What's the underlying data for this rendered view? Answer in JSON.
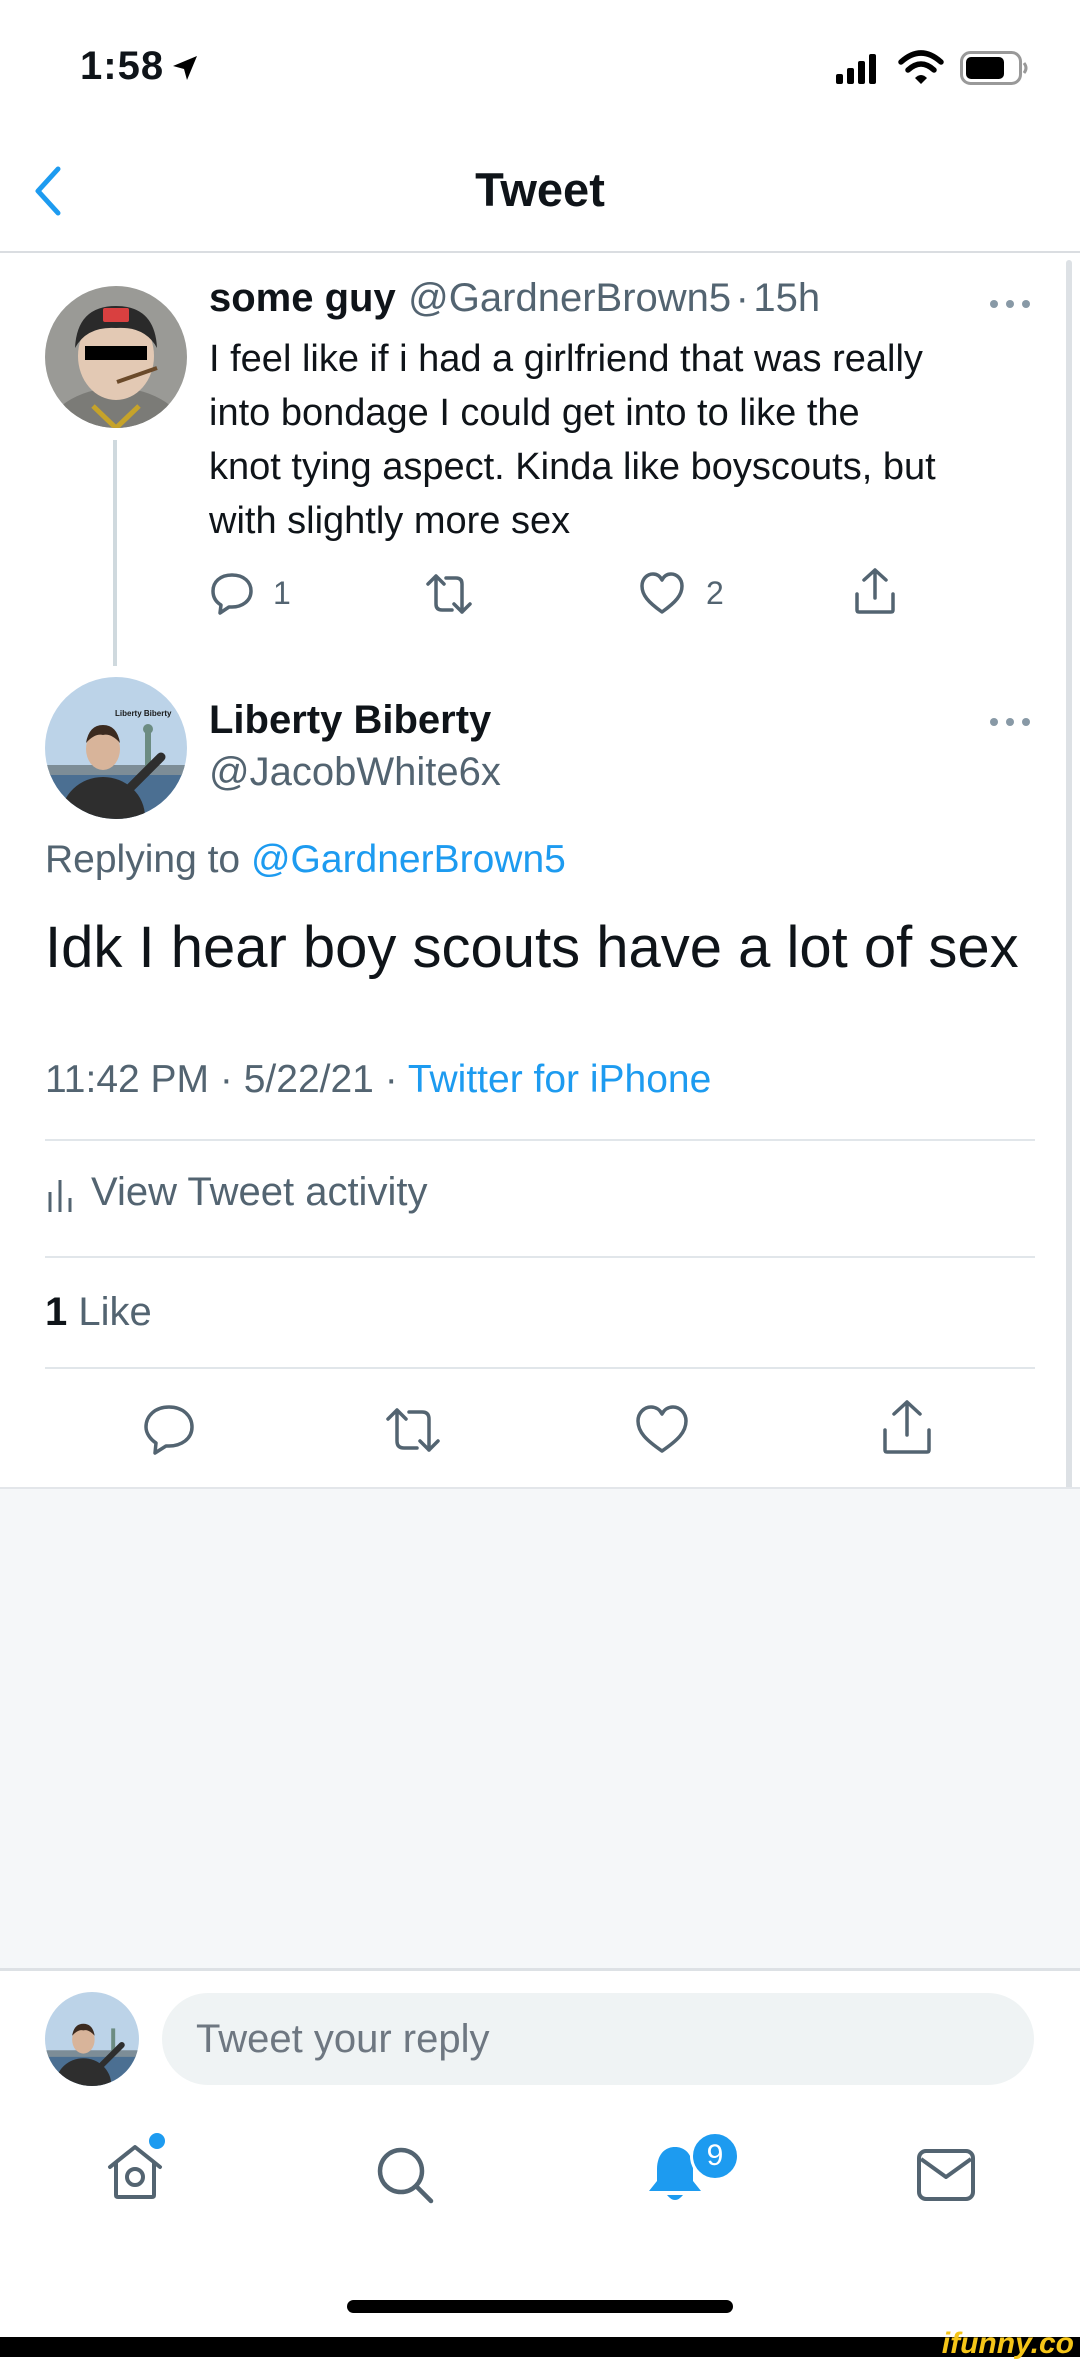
{
  "status_bar": {
    "time": "1:58"
  },
  "nav": {
    "title": "Tweet"
  },
  "parent_tweet": {
    "name": "some guy",
    "handle": "@GardnerBrown5",
    "separator": "·",
    "age": "15h",
    "lines": [
      "I feel like if i had a girlfriend that was really",
      "into bondage I could get into to like the",
      "knot tying aspect. Kinda like boyscouts, but",
      "with slightly more sex"
    ],
    "reply_count": "1",
    "like_count": "2"
  },
  "main_tweet": {
    "name": "Liberty Biberty",
    "handle": "@JacobWhite6x",
    "avatar_caption": "Liberty Biberty",
    "replying_prefix": "Replying to ",
    "replying_handle": "@GardnerBrown5",
    "text": "Idk I hear boy scouts have a lot of sex",
    "time": "11:42 PM",
    "date": "5/22/21",
    "separator": "·",
    "source": "Twitter for iPhone",
    "activity_label": "View Tweet activity",
    "likes_count": "1",
    "likes_label": "Like"
  },
  "compose": {
    "placeholder": "Tweet your reply"
  },
  "tab_bar": {
    "notifications_badge": "9"
  },
  "watermark": "ifunny.co",
  "colors": {
    "accent": "#1d9bf0",
    "text": "#0f1419",
    "secondary": "#536471"
  }
}
